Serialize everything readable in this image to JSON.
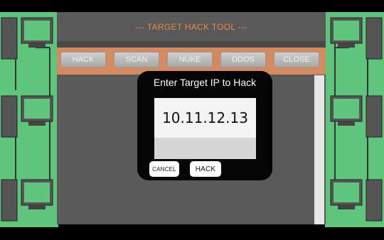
{
  "app": {
    "title": "--- TARGET HACK TOOL ---"
  },
  "toolbar": {
    "buttons": [
      {
        "label": "HACK"
      },
      {
        "label": "SCAN"
      },
      {
        "label": "NUKE"
      },
      {
        "label": "DDOS"
      },
      {
        "label": "CLOSE"
      }
    ]
  },
  "dialog": {
    "title": "Enter Target IP to Hack",
    "ip_value": "10.11.12.13",
    "cancel_label": "CANCEL",
    "hack_label": "HACK"
  },
  "decor": {
    "side_panel_icon": "computer-network-icon"
  },
  "colors": {
    "side_panel": "#5fc47c",
    "title_text": "#e88a4c",
    "toolbar_bg": "#d48a5f",
    "main_bg": "#595959",
    "dialog_bg": "#050505"
  }
}
